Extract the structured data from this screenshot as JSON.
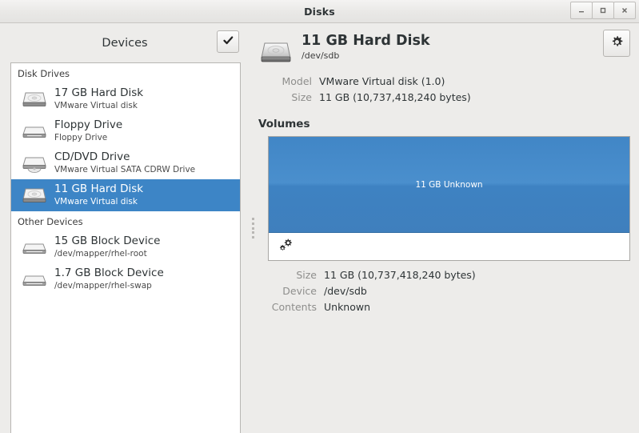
{
  "window": {
    "title": "Disks",
    "controls": [
      {
        "name": "minimize",
        "glyph": "–"
      },
      {
        "name": "maximize",
        "glyph": "□"
      },
      {
        "name": "close",
        "glyph": "✕"
      }
    ]
  },
  "sidebar": {
    "header_title": "Devices",
    "check_button_icon": "checkmark-icon",
    "groups": [
      {
        "label": "Disk Drives",
        "items": [
          {
            "name": "17 GB Hard Disk",
            "sub": "VMware Virtual disk",
            "icon": "hard-disk-icon",
            "selected": false
          },
          {
            "name": "Floppy Drive",
            "sub": "Floppy Drive",
            "icon": "floppy-drive-icon",
            "selected": false
          },
          {
            "name": "CD/DVD Drive",
            "sub": "VMware Virtual SATA CDRW Drive",
            "icon": "optical-drive-icon",
            "selected": false
          },
          {
            "name": "11 GB Hard Disk",
            "sub": "VMware Virtual disk",
            "icon": "hard-disk-icon",
            "selected": true
          }
        ]
      },
      {
        "label": "Other Devices",
        "items": [
          {
            "name": "15 GB Block Device",
            "sub": "/dev/mapper/rhel-root",
            "icon": "block-device-icon",
            "selected": false
          },
          {
            "name": "1.7 GB Block Device",
            "sub": "/dev/mapper/rhel-swap",
            "icon": "block-device-icon",
            "selected": false
          }
        ]
      }
    ]
  },
  "detail": {
    "icon": "hard-disk-icon",
    "title": "11 GB Hard Disk",
    "device_path": "/dev/sdb",
    "settings_button_icon": "gear-icon",
    "properties": [
      {
        "key": "Model",
        "value": "VMware Virtual disk (1.0)"
      },
      {
        "key": "Size",
        "value": "11 GB (10,737,418,240 bytes)"
      }
    ],
    "volumes": {
      "heading": "Volumes",
      "segments": [
        {
          "label": "11 GB Unknown",
          "color": "#4186c6",
          "width_pct": 100,
          "selected": true
        }
      ],
      "toolbar": [
        {
          "name": "volume-options-button",
          "icon": "gears-icon"
        }
      ],
      "properties": [
        {
          "key": "Size",
          "value": "11 GB (10,737,418,240 bytes)"
        },
        {
          "key": "Device",
          "value": "/dev/sdb"
        },
        {
          "key": "Contents",
          "value": "Unknown"
        }
      ]
    }
  },
  "colors": {
    "selection_blue": "#3d85c6",
    "volume_blue": "#4186c6",
    "window_bg": "#edecea",
    "list_bg": "#ffffff"
  }
}
